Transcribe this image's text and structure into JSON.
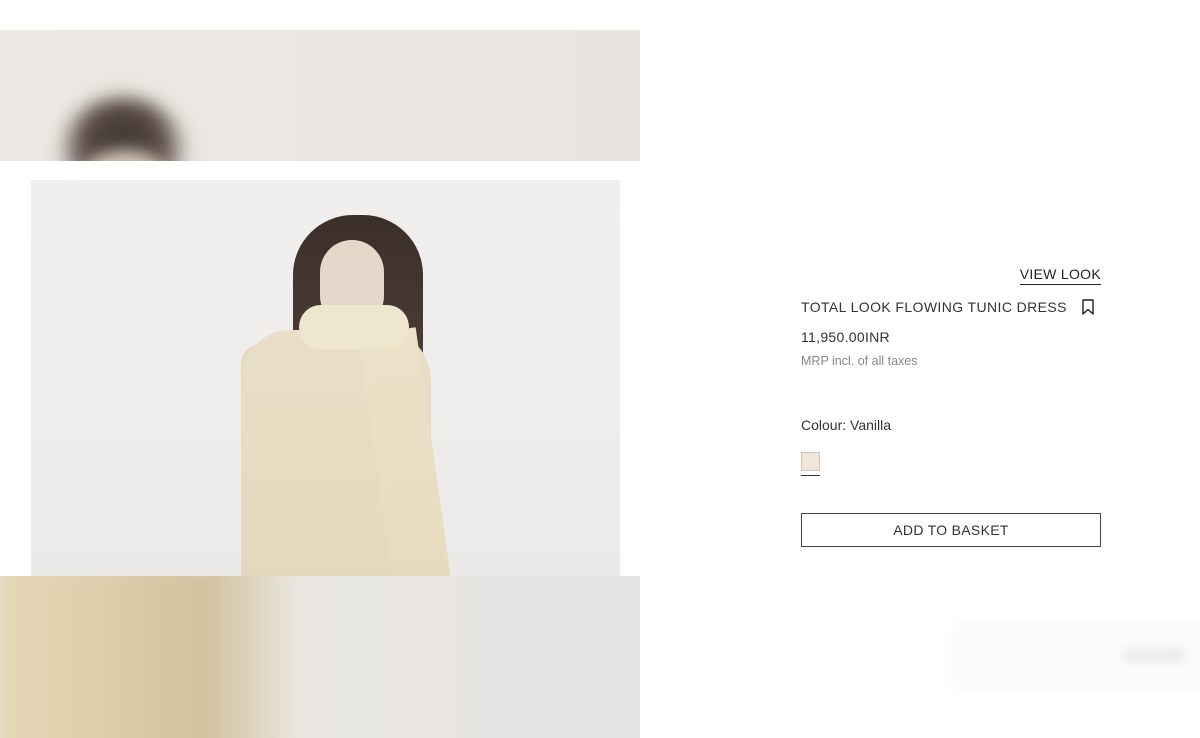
{
  "product": {
    "view_look": "VIEW LOOK",
    "title": "TOTAL LOOK FLOWING TUNIC DRESS",
    "price": "11,950.00INR",
    "tax_note": "MRP incl. of all taxes",
    "colour_label": "Colour: Vanilla",
    "swatch_color": "#f1e6d9",
    "add_to_basket": "ADD TO BASKET"
  },
  "icons": {
    "bookmark": "bookmark-icon"
  }
}
